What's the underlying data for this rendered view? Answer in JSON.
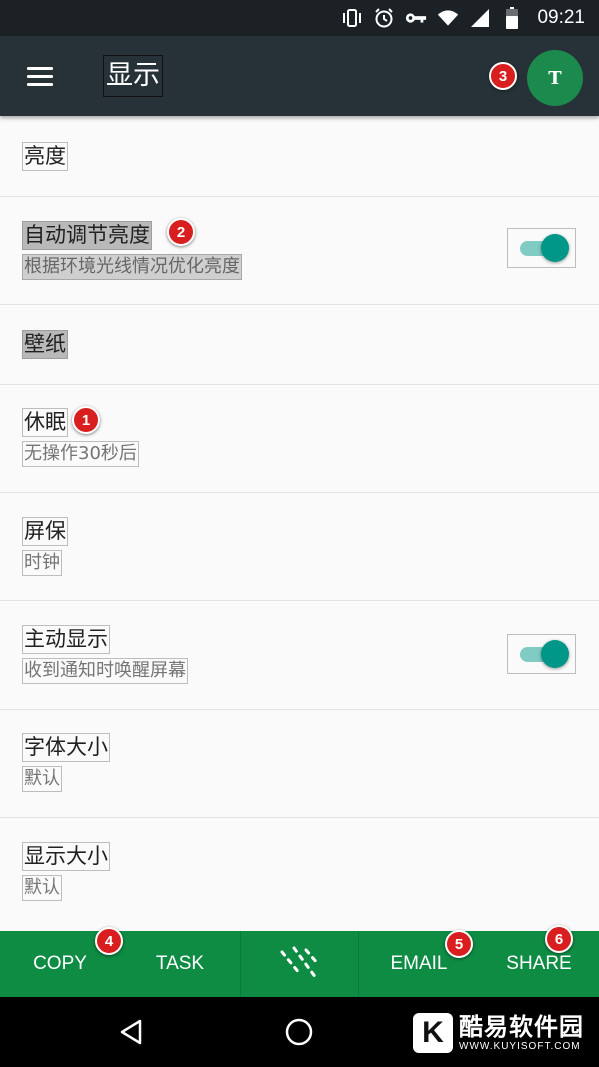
{
  "status_bar": {
    "time": "09:21",
    "icons": [
      "vibrate-icon",
      "alarm-icon",
      "vpn-key-icon",
      "wifi-icon",
      "signal-icon",
      "battery-icon"
    ]
  },
  "app_bar": {
    "title": "显示",
    "avatar_letter": "T",
    "colors": {
      "bar": "#263238",
      "avatar": "#1b8a4c"
    }
  },
  "settings": [
    {
      "title": "亮度",
      "subtitle": null,
      "toggle": null
    },
    {
      "title": "自动调节亮度",
      "subtitle": "根据环境光线情况优化亮度",
      "toggle": true
    },
    {
      "title": "壁纸",
      "subtitle": null,
      "toggle": null
    },
    {
      "title": "休眠",
      "subtitle": "无操作30秒后",
      "toggle": null
    },
    {
      "title": "屏保",
      "subtitle": "时钟",
      "toggle": null
    },
    {
      "title": "主动显示",
      "subtitle": "收到通知时唤醒屏幕",
      "toggle": true
    },
    {
      "title": "字体大小",
      "subtitle": "默认",
      "toggle": null
    },
    {
      "title": "显示大小",
      "subtitle": "默认",
      "toggle": null
    }
  ],
  "badges": [
    "1",
    "2",
    "3",
    "4",
    "5",
    "6"
  ],
  "action_bar": {
    "copy": "COPY",
    "task": "TASK",
    "email": "EMAIL",
    "share": "SHARE",
    "center_icon": "dotted-lines-icon",
    "color": "#0e8c44"
  },
  "nav_bar": {
    "back": "back-icon",
    "home": "home-icon"
  },
  "watermark": {
    "logo_letter": "K",
    "cn": "酷易软件园",
    "en": "WWW.KUYISOFT.COM"
  },
  "accent_color": "#009688"
}
